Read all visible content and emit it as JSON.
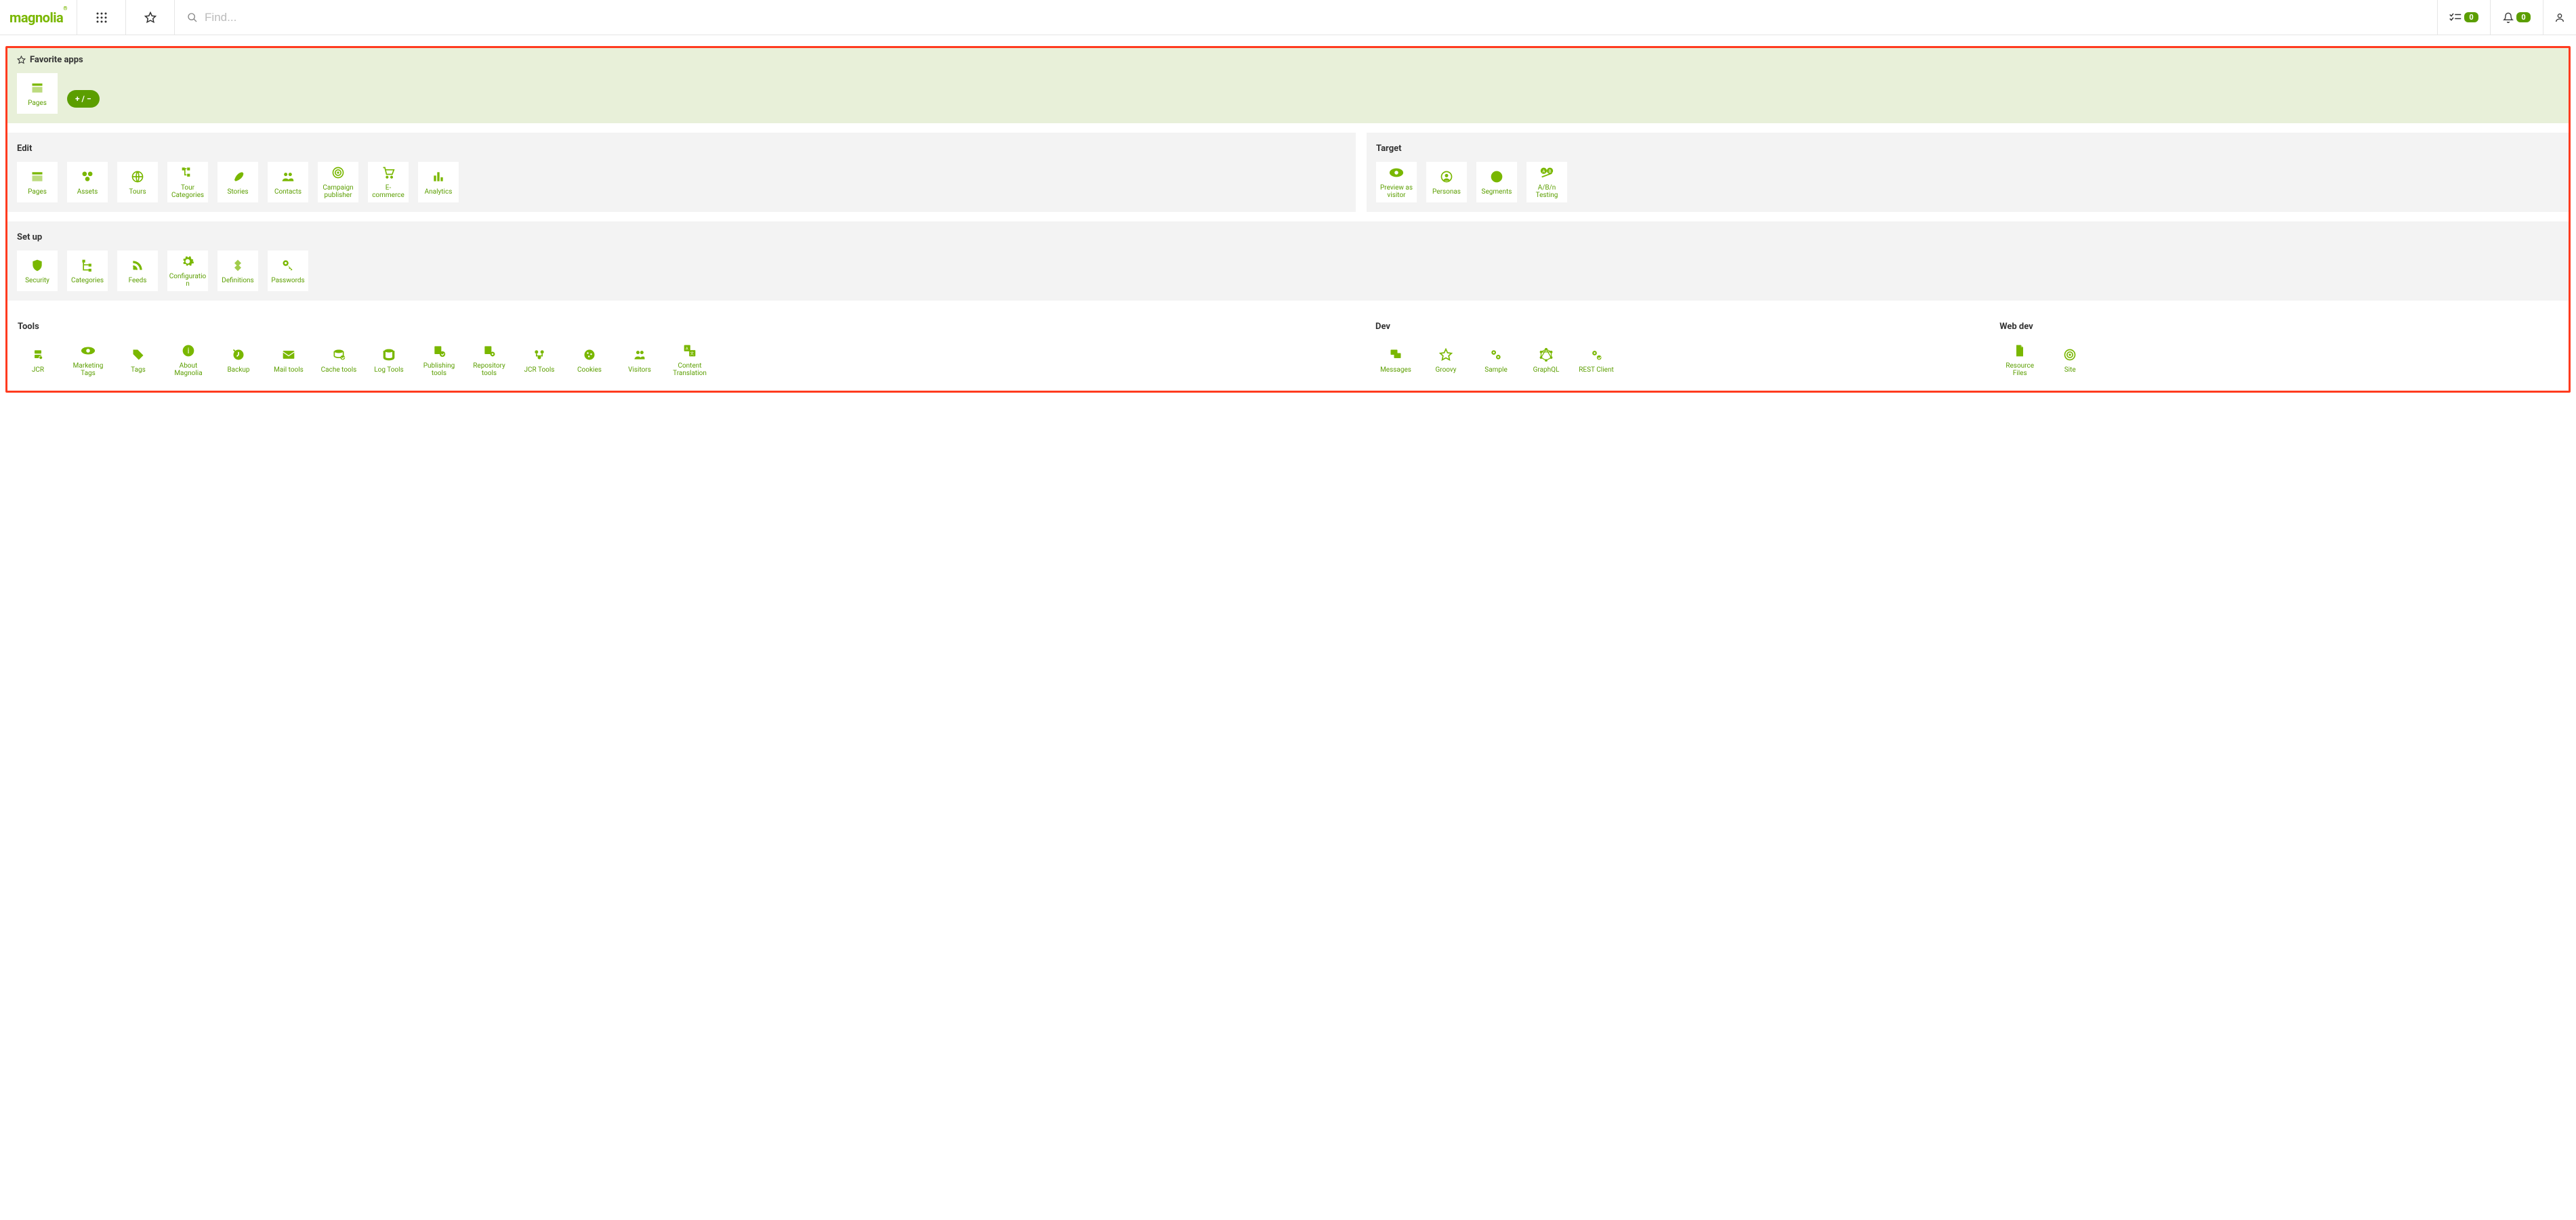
{
  "header": {
    "logo": "magnolia",
    "search_placeholder": "Find...",
    "tasks_count": "0",
    "notif_count": "0"
  },
  "favorites": {
    "title": "Favorite apps",
    "add_label": "+ / −",
    "items": [
      {
        "label": "Pages",
        "icon": "pages"
      }
    ]
  },
  "groups": {
    "edit": {
      "title": "Edit",
      "items": [
        {
          "label": "Pages",
          "icon": "pages"
        },
        {
          "label": "Assets",
          "icon": "assets"
        },
        {
          "label": "Tours",
          "icon": "globe"
        },
        {
          "label": "Tour Categories",
          "icon": "tree"
        },
        {
          "label": "Stories",
          "icon": "feather"
        },
        {
          "label": "Contacts",
          "icon": "people"
        },
        {
          "label": "Campaign publisher",
          "icon": "target"
        },
        {
          "label": "E-commerce",
          "icon": "cart"
        },
        {
          "label": "Analytics",
          "icon": "bars"
        }
      ]
    },
    "target": {
      "title": "Target",
      "items": [
        {
          "label": "Preview as visitor",
          "icon": "eye"
        },
        {
          "label": "Personas",
          "icon": "persona"
        },
        {
          "label": "Segments",
          "icon": "pie"
        },
        {
          "label": "A/B/n Testing",
          "icon": "ab"
        }
      ]
    },
    "setup": {
      "title": "Set up",
      "items": [
        {
          "label": "Security",
          "icon": "shield"
        },
        {
          "label": "Categories",
          "icon": "tree2"
        },
        {
          "label": "Feeds",
          "icon": "rss"
        },
        {
          "label": "Configuration",
          "icon": "gear"
        },
        {
          "label": "Definitions",
          "icon": "diamond"
        },
        {
          "label": "Passwords",
          "icon": "key"
        }
      ]
    },
    "tools": {
      "title": "Tools",
      "items": [
        {
          "label": "JCR",
          "icon": "db"
        },
        {
          "label": "Marketing Tags",
          "icon": "eye2"
        },
        {
          "label": "Tags",
          "icon": "tag"
        },
        {
          "label": "About Magnolia",
          "icon": "info"
        },
        {
          "label": "Backup",
          "icon": "backup"
        },
        {
          "label": "Mail tools",
          "icon": "mail"
        },
        {
          "label": "Cache tools",
          "icon": "cache"
        },
        {
          "label": "Log Tools",
          "icon": "log"
        },
        {
          "label": "Publishing tools",
          "icon": "publish"
        },
        {
          "label": "Repository tools",
          "icon": "repo"
        },
        {
          "label": "JCR Tools",
          "icon": "jcrtools"
        },
        {
          "label": "Cookies",
          "icon": "cookie"
        },
        {
          "label": "Visitors",
          "icon": "visitors"
        },
        {
          "label": "Content Translation",
          "icon": "translate"
        }
      ]
    },
    "dev": {
      "title": "Dev",
      "items": [
        {
          "label": "Messages",
          "icon": "chat"
        },
        {
          "label": "Groovy",
          "icon": "star"
        },
        {
          "label": "Sample",
          "icon": "gears"
        },
        {
          "label": "GraphQL",
          "icon": "graphql"
        },
        {
          "label": "REST Client",
          "icon": "rest"
        }
      ]
    },
    "webdev": {
      "title": "Web dev",
      "items": [
        {
          "label": "Resource Files",
          "icon": "file"
        },
        {
          "label": "Site",
          "icon": "site"
        }
      ]
    }
  }
}
